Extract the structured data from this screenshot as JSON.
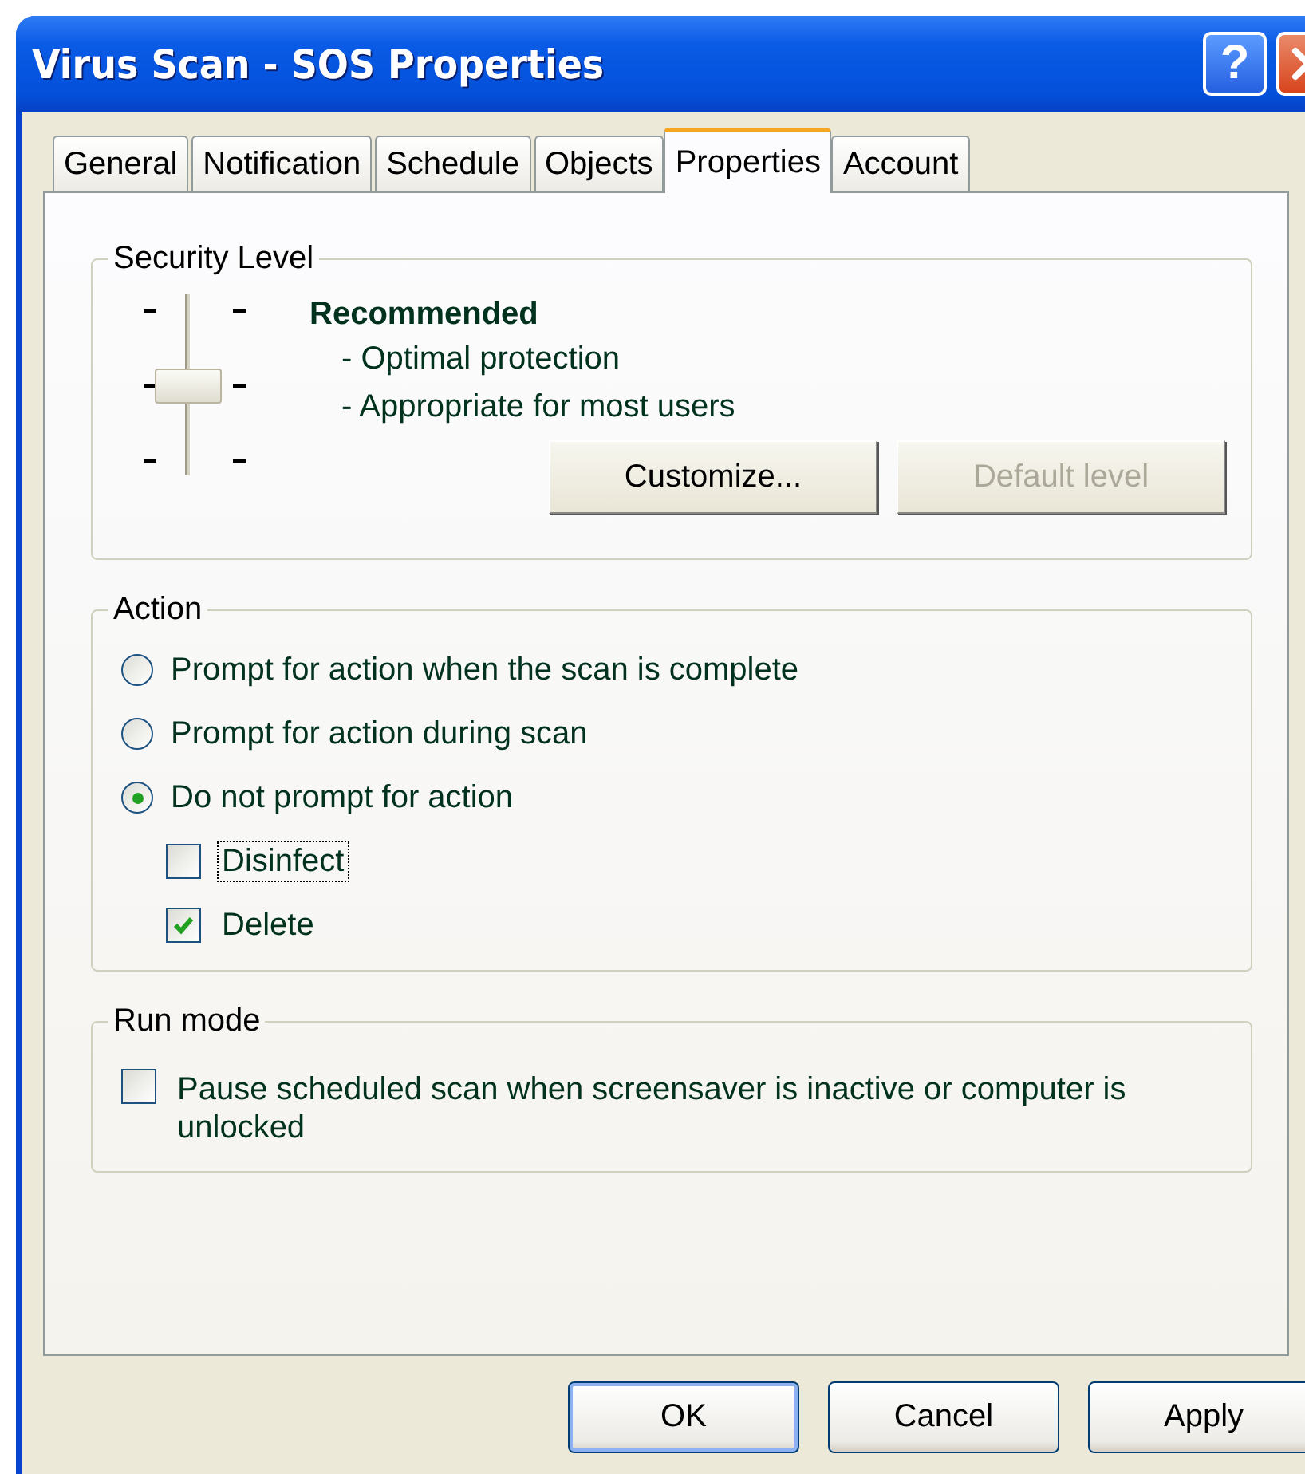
{
  "window": {
    "title": "Virus Scan - SOS Properties",
    "help_button": "?"
  },
  "tabs": [
    {
      "label": "General",
      "selected": false
    },
    {
      "label": "Notification",
      "selected": false
    },
    {
      "label": "Schedule",
      "selected": false
    },
    {
      "label": "Objects",
      "selected": false
    },
    {
      "label": "Properties",
      "selected": true
    },
    {
      "label": "Account",
      "selected": false
    }
  ],
  "security_level": {
    "title": "Security Level",
    "slider": {
      "level": 0.5
    },
    "heading": "Recommended",
    "details": [
      "- Optimal protection",
      "- Appropriate for most users"
    ],
    "buttons": [
      {
        "label": "Customize...",
        "disabled": false
      },
      {
        "label": "Default level",
        "disabled": true
      }
    ]
  },
  "action": {
    "title": "Action",
    "options": [
      {
        "label": "Prompt for action when the scan is complete",
        "selected": false
      },
      {
        "label": "Prompt for action during scan",
        "selected": false
      },
      {
        "label": "Do not prompt for action",
        "selected": true
      }
    ],
    "checkboxes": [
      {
        "label": "Disinfect",
        "checked": false,
        "focused": true
      },
      {
        "label": "Delete",
        "checked": true,
        "focused": false
      }
    ]
  },
  "run_mode": {
    "title": "Run mode",
    "checkbox": {
      "label": "Pause scheduled scan when screensaver is inactive or computer is unlocked",
      "checked": false
    }
  },
  "buttons": [
    {
      "label": "OK",
      "default": true
    },
    {
      "label": "Cancel",
      "default": false
    },
    {
      "label": "Apply",
      "default": false
    }
  ]
}
